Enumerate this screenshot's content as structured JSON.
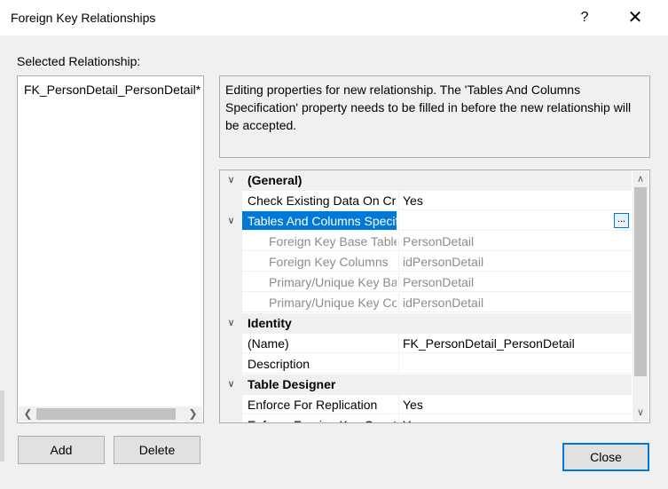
{
  "window": {
    "title": "Foreign Key Relationships",
    "help_label": "?",
    "close_glyph": "✕"
  },
  "left": {
    "label": "Selected Relationship:",
    "relationships": [
      "FK_PersonDetail_PersonDetail*"
    ]
  },
  "description": "Editing properties for new relationship.  The 'Tables And Columns Specification' property needs to be filled in before the new relationship will be accepted.",
  "grid": {
    "general": {
      "label": "(General)",
      "check_existing": {
        "name": "Check Existing Data On Creation Or Re-Enabling",
        "value": "Yes"
      },
      "tables_columns": {
        "name": "Tables And Columns Specification",
        "value": "",
        "button": "..."
      },
      "fk_base_table": {
        "name": "Foreign Key Base Table",
        "value": "PersonDetail"
      },
      "fk_columns": {
        "name": "Foreign Key Columns",
        "value": "idPersonDetail"
      },
      "pk_base_table": {
        "name": "Primary/Unique Key Base Table",
        "value": "PersonDetail"
      },
      "pk_columns": {
        "name": "Primary/Unique Key Columns",
        "value": "idPersonDetail"
      }
    },
    "identity": {
      "label": "Identity",
      "name": {
        "name": "(Name)",
        "value": "FK_PersonDetail_PersonDetail"
      },
      "description": {
        "name": "Description",
        "value": ""
      }
    },
    "table_designer": {
      "label": "Table Designer",
      "enforce_replication": {
        "name": "Enforce For Replication",
        "value": "Yes"
      },
      "enforce_fk": {
        "name": "Enforce Foreign Key Constraint",
        "value": "Yes"
      }
    }
  },
  "buttons": {
    "add": "Add",
    "delete": "Delete",
    "close": "Close"
  },
  "colors": {
    "selection": "#0078d7",
    "dialog_bg": "#f0f0f0",
    "disabled_text": "#8c8c8c"
  }
}
